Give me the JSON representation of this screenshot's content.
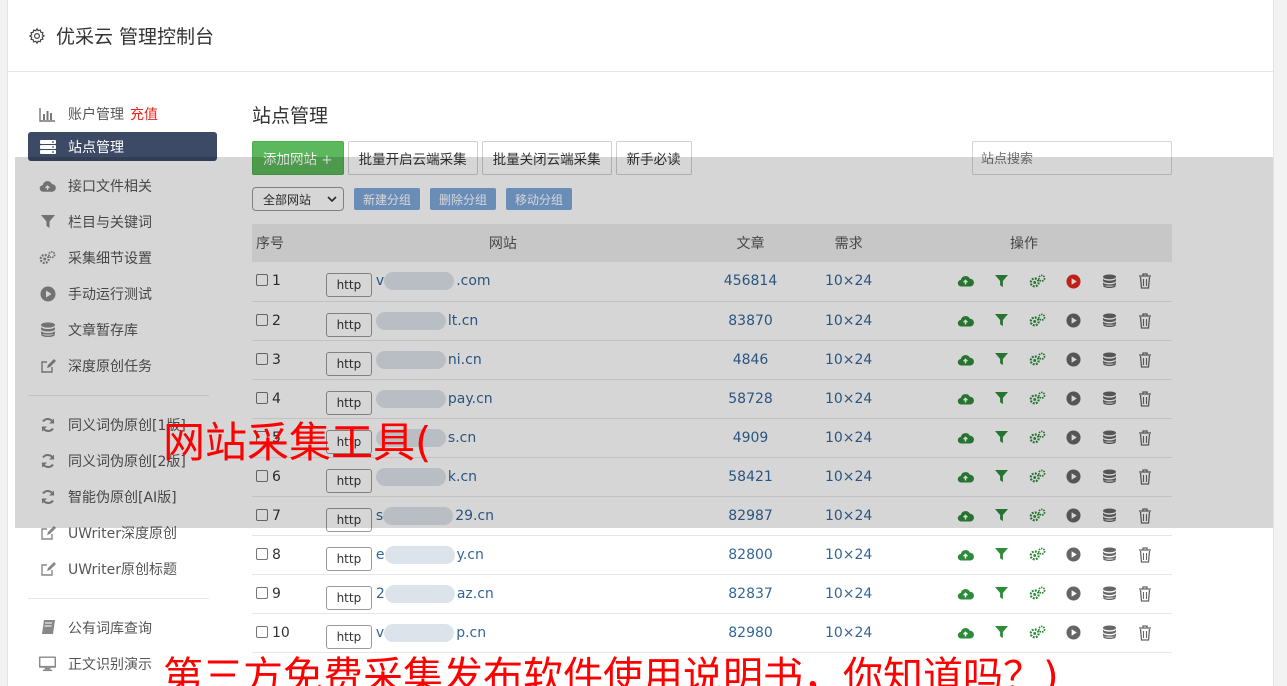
{
  "header": {
    "title": "优采云 管理控制台"
  },
  "sidebar": {
    "items": [
      {
        "label": "账户管理",
        "icon": "bar-chart-icon",
        "extra": "充值"
      },
      {
        "label": "站点管理",
        "icon": "server-icon",
        "active": true
      },
      {
        "label": "接口文件相关",
        "icon": "cloud-upload-icon"
      },
      {
        "label": "栏目与关键词",
        "icon": "filter-icon"
      },
      {
        "label": "采集细节设置",
        "icon": "gears-icon"
      },
      {
        "label": "手动运行测试",
        "icon": "play-circle-icon"
      },
      {
        "label": "文章暂存库",
        "icon": "database-icon"
      },
      {
        "label": "深度原创任务",
        "icon": "edit-icon"
      }
    ],
    "items2": [
      {
        "label": "同义词伪原创[1版]",
        "icon": "refresh-icon"
      },
      {
        "label": "同义词伪原创[2版]",
        "icon": "refresh-icon"
      },
      {
        "label": "智能伪原创[AI版]",
        "icon": "refresh-icon"
      },
      {
        "label": "UWriter深度原创",
        "icon": "edit-icon"
      },
      {
        "label": "UWriter原创标题",
        "icon": "edit-icon"
      }
    ],
    "items3": [
      {
        "label": "公有词库查询",
        "icon": "book-icon"
      },
      {
        "label": "正文识别演示",
        "icon": "monitor-icon"
      }
    ]
  },
  "main": {
    "title": "站点管理",
    "toolbar": {
      "add_site": "添加网站 +",
      "batch_open": "批量开启云端采集",
      "batch_close": "批量关闭云端采集",
      "newbie": "新手必读",
      "search_placeholder": "站点搜索"
    },
    "group": {
      "select_value": "全部网站",
      "new_group": "新建分组",
      "delete_group": "删除分组",
      "move_group": "移动分组"
    },
    "table": {
      "headers": {
        "no": "序号",
        "site": "网站",
        "articles": "文章",
        "demand": "需求",
        "ops": "操作"
      },
      "rows": [
        {
          "no": "1",
          "proto": "http",
          "prefix": "v",
          "domain": ".com",
          "articles": "456814",
          "demand": "10×24",
          "running": true
        },
        {
          "no": "2",
          "proto": "http",
          "prefix": "",
          "domain": "lt.cn",
          "articles": "83870",
          "demand": "10×24",
          "running": false
        },
        {
          "no": "3",
          "proto": "http",
          "prefix": "",
          "domain": "ni.cn",
          "articles": "4846",
          "demand": "10×24",
          "running": false
        },
        {
          "no": "4",
          "proto": "http",
          "prefix": "",
          "domain": "pay.cn",
          "articles": "58728",
          "demand": "10×24",
          "running": false
        },
        {
          "no": "5",
          "proto": "http",
          "prefix": "",
          "domain": "s.cn",
          "articles": "4909",
          "demand": "10×24",
          "running": false
        },
        {
          "no": "6",
          "proto": "http",
          "prefix": "",
          "domain": "k.cn",
          "articles": "58421",
          "demand": "10×24",
          "running": false
        },
        {
          "no": "7",
          "proto": "http",
          "prefix": "s",
          "domain": "29.cn",
          "articles": "82987",
          "demand": "10×24",
          "running": false
        },
        {
          "no": "8",
          "proto": "http",
          "prefix": "e",
          "domain": "y.cn",
          "articles": "82800",
          "demand": "10×24",
          "running": false
        },
        {
          "no": "9",
          "proto": "http",
          "prefix": "2",
          "domain": "az.cn",
          "articles": "82837",
          "demand": "10×24",
          "running": false
        },
        {
          "no": "10",
          "proto": "http",
          "prefix": "v",
          "domain": "p.cn",
          "articles": "82980",
          "demand": "10×24",
          "running": false
        }
      ]
    }
  },
  "captions": {
    "caption1": "网站采集工具(",
    "caption2": "第三方免费采集发布软件使用说明书，你知道吗？)"
  },
  "colors": {
    "accent": "#3c4a66",
    "green": "#5cb85c",
    "link": "#336699",
    "caption": "#ff0000",
    "stop": "#e8261b"
  }
}
